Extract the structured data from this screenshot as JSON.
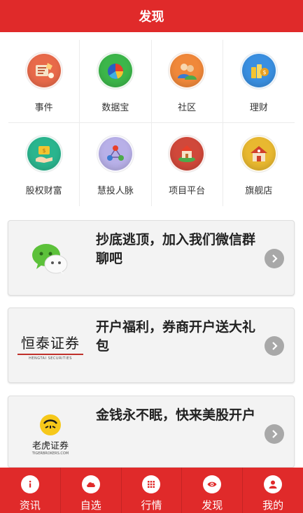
{
  "header": {
    "title": "发现"
  },
  "grid": {
    "items": [
      {
        "label": "事件",
        "icon": "event-icon",
        "color": "#e86a4a"
      },
      {
        "label": "数据宝",
        "icon": "data-chart-icon",
        "color": "#3cb64a"
      },
      {
        "label": "社区",
        "icon": "community-icon",
        "color": "#f0883a"
      },
      {
        "label": "理财",
        "icon": "finance-icon",
        "color": "#3a8fe0"
      },
      {
        "label": "股权财富",
        "icon": "equity-icon",
        "color": "#2ab58e"
      },
      {
        "label": "慧投人脉",
        "icon": "network-icon",
        "color": "#8a7fd0"
      },
      {
        "label": "项目平台",
        "icon": "project-icon",
        "color": "#d0483a"
      },
      {
        "label": "旗舰店",
        "icon": "store-icon",
        "color": "#e8b830"
      }
    ]
  },
  "cards": [
    {
      "text": "抄底逃顶，加入我们微信群聊吧",
      "logo": "wechat-logo"
    },
    {
      "text": "开户福利，券商开户送大礼包",
      "logo": "hengtai-logo",
      "logo_text": "恒泰证券",
      "logo_sub": "HENGTAI SECURITIES"
    },
    {
      "text": "金钱永不眠，快来美股开户",
      "logo": "tiger-logo",
      "logo_text": "老虎证券",
      "logo_sub": "TIGERBROKERS.COM"
    }
  ],
  "nav": {
    "items": [
      {
        "label": "资讯",
        "icon": "info-icon"
      },
      {
        "label": "自选",
        "icon": "cloud-icon"
      },
      {
        "label": "行情",
        "icon": "grid-icon"
      },
      {
        "label": "发现",
        "icon": "eye-icon"
      },
      {
        "label": "我的",
        "icon": "user-icon"
      }
    ]
  },
  "colors": {
    "brand_red": "#e02a2a",
    "arrow_gray": "#a8a8a8"
  }
}
